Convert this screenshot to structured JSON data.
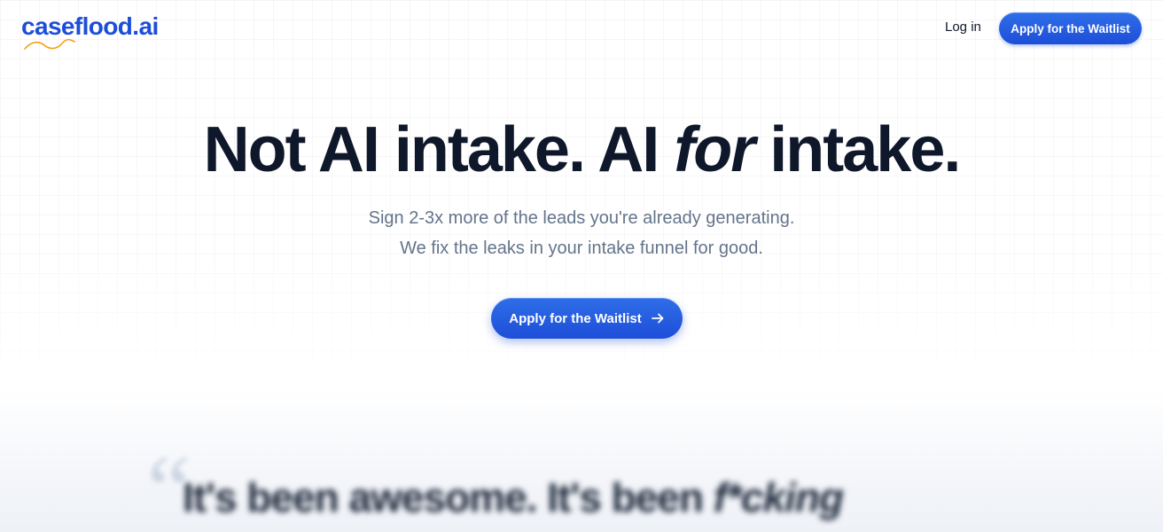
{
  "header": {
    "logo_text": "caseflood.ai",
    "login_label": "Log in",
    "cta_label": "Apply for the Waitlist"
  },
  "hero": {
    "title_part1": "Not AI intake. AI ",
    "title_emphasis": "for",
    "title_part2": " intake.",
    "subtitle_line1": "Sign 2-3x more of the leads you're already generating.",
    "subtitle_line2": "We fix the leaks in your intake funnel for good.",
    "cta_label": "Apply for the Waitlist",
    "cta_icon": "arrow-right-icon"
  },
  "testimonial": {
    "quote_mark": "“",
    "quote_part1": "It's been awesome. It's been ",
    "quote_emphasis": "f*cking"
  },
  "colors": {
    "brand": "#1d4ed8",
    "text": "#0f172a",
    "muted": "#64748b",
    "logo_swoosh": "#f59e0b"
  }
}
